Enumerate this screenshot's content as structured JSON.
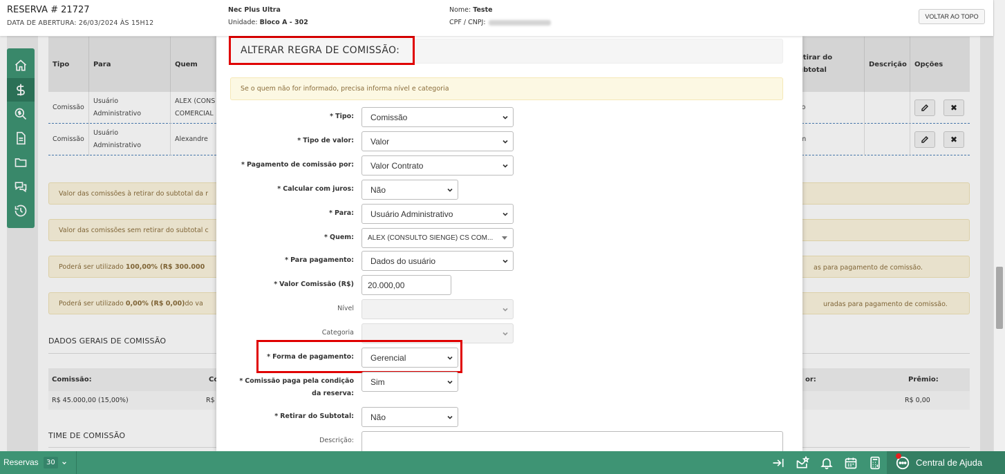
{
  "header": {
    "reservation_title": "RESERVA # 21727",
    "opening_date": "DATA DE ABERTURA: 26/03/2024 ÀS 15H12",
    "enterprise": "Nec Plus Ultra",
    "unit_label": "Unidade:",
    "unit_value": "Bloco A - 302",
    "client_label": "Nome:",
    "client_value": "Teste",
    "cpf_label": "CPF / CNPJ:",
    "back_to_top": "VOLTAR AO TOPO"
  },
  "sidebar": {
    "items": [
      {
        "icon": "home-icon"
      },
      {
        "icon": "dollar-icon"
      },
      {
        "icon": "search-dollar-icon"
      },
      {
        "icon": "document-icon"
      },
      {
        "icon": "folder-icon"
      },
      {
        "icon": "chat-icon"
      },
      {
        "icon": "history-icon"
      }
    ]
  },
  "background_table": {
    "headers": [
      "Tipo",
      "Para",
      "Quem",
      "etirar do",
      "ubtotal",
      "Descrição",
      "Opções"
    ],
    "rows": [
      {
        "tipo": "Comissão",
        "para_1": "Usuário",
        "para_2": "Administrativo",
        "quem_1": "ALEX (CONS",
        "quem_2": "COMERCIAL",
        "retirar": "io"
      },
      {
        "tipo": "Comissão",
        "para_1": "Usuário",
        "para_2": "Administrativo",
        "quem_1": "Alexandre",
        "quem_2": "",
        "retirar": "m"
      }
    ]
  },
  "background_alerts": {
    "a1": "Valor das comissões à retirar do subtotal da r",
    "a2": "Valor das comissões sem retirar do subtotal c",
    "a3_pre": "Poderá ser utilizado ",
    "a3_bold": "100,00% (R$ 300.000",
    "a3_right": "as para pagamento de comissão.",
    "a4_pre": "Poderá ser utilizado ",
    "a4_bold": "0,00% (R$ 0,00)",
    "a4_mid": " do va",
    "a4_right": "uradas para pagamento de comissão."
  },
  "background_sections": {
    "general_title": "DADOS GERAIS DE COMISSÃO",
    "commission_label": "Comissão:",
    "co_label": "Co",
    "or_label": "or:",
    "premio_label": "Prêmio:",
    "commission_value": "R$ 45.000,00 (15,00%)",
    "rs_cut": "R$",
    "premio_value": "R$ 0,00",
    "team_title": "TIME DE COMISSÃO"
  },
  "modal": {
    "title": "ALTERAR REGRA DE COMISSÃO:",
    "warning": "Se o quem não for informado, precisa informa nível e categoria",
    "fields": {
      "tipo": {
        "label": "Tipo:",
        "value": "Comissão"
      },
      "tipo_valor": {
        "label": "Tipo de valor:",
        "value": "Valor"
      },
      "pagamento_por": {
        "label": "Pagamento de comissão por:",
        "value": "Valor Contrato"
      },
      "juros": {
        "label": "Calcular com juros:",
        "value": "Não"
      },
      "para": {
        "label": "Para:",
        "value": "Usuário Administrativo"
      },
      "quem": {
        "label": "Quem:",
        "value": "ALEX (CONSULTO SIENGE) CS COM..."
      },
      "para_pagamento": {
        "label": "Para pagamento:",
        "value": "Dados do usuário"
      },
      "valor_comissao": {
        "label": "Valor Comissão (R$)",
        "value": "20.000,00"
      },
      "nivel": {
        "label": "Nível",
        "value": ""
      },
      "categoria": {
        "label": "Categoria",
        "value": ""
      },
      "forma_pagamento": {
        "label": "Forma de pagamento:",
        "value": "Gerencial"
      },
      "condicao_1": {
        "label": "Comissão paga pela condição",
        "value": "Sim"
      },
      "condicao_2": {
        "label": "da reserva:"
      },
      "retirar": {
        "label": "Retirar do Subtotal:",
        "value": "Não"
      },
      "descricao": {
        "label": "Descrição:"
      }
    }
  },
  "bottombar": {
    "reservas_label": "Reservas",
    "reservas_count": "30",
    "help_label": "Central de Ajuda"
  }
}
